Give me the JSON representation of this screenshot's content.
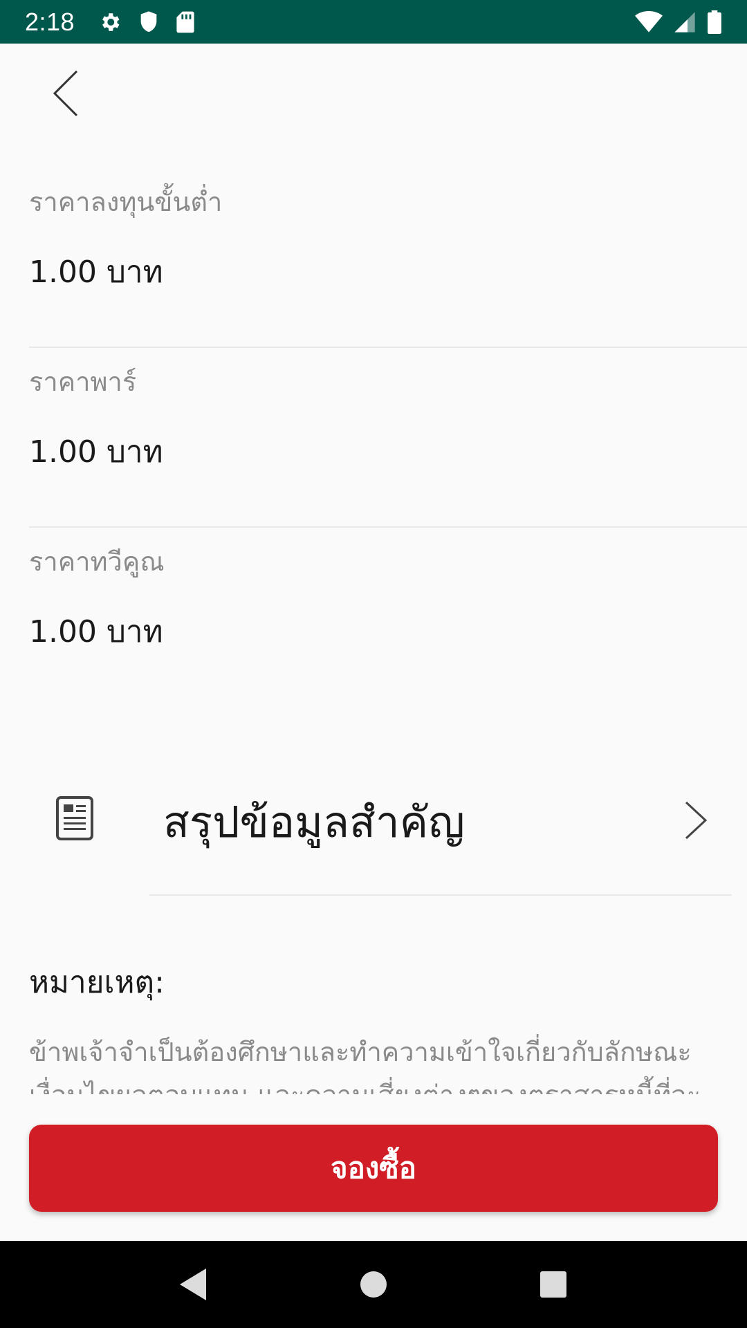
{
  "status_bar": {
    "time": "2:18",
    "icons": [
      "settings-icon",
      "shield-icon",
      "sd-card-icon",
      "wifi-icon",
      "signal-icon",
      "battery-icon"
    ]
  },
  "header": {
    "back_icon": "chevron-left-icon"
  },
  "info_rows": [
    {
      "label": "ราคาลงทุนขั้นต่ำ",
      "value": "1.00 บาท"
    },
    {
      "label": "ราคาพาร์",
      "value": "1.00 บาท"
    },
    {
      "label": "ราคาทวีคูณ",
      "value": "1.00 บาท"
    }
  ],
  "summary": {
    "icon": "document-icon",
    "title": "สรุปข้อมูลสำคัญ",
    "chevron": "chevron-right-icon"
  },
  "note": {
    "title": "หมายเหตุ:",
    "text": "ข้าพเจ้าจำเป็นต้องศึกษาและทำความเข้าใจเกี่ยวกับลักษณะ เงื่อนไขผลตอบแทน และความเสี่ยงต่างๆของตราสารหนี้ที่จะลงทุน"
  },
  "actions": {
    "reserve_label": "จองซื้อ"
  },
  "colors": {
    "status_bar": "#00574b",
    "primary": "#d11d25",
    "label_gray": "#8a8a8a"
  },
  "nav_bar": {
    "icons": [
      "back-triangle-icon",
      "home-circle-icon",
      "recents-square-icon"
    ]
  }
}
